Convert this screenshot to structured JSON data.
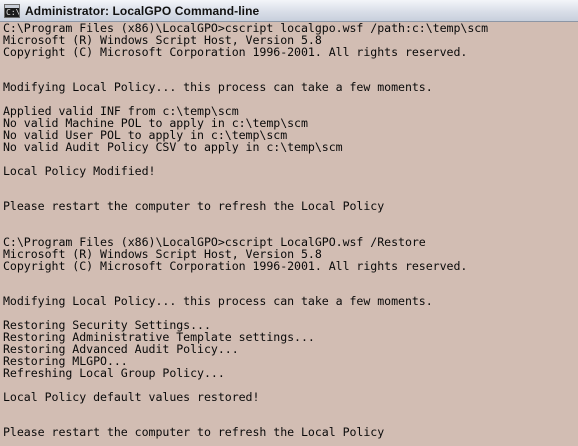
{
  "window": {
    "title": "Administrator: LocalGPO Command-line",
    "icon": "console-icon",
    "icon_glyph": "C:\\"
  },
  "console": {
    "lines": [
      "C:\\Program Files (x86)\\LocalGPO>cscript localgpo.wsf /path:c:\\temp\\scm",
      "Microsoft (R) Windows Script Host, Version 5.8",
      "Copyright (C) Microsoft Corporation 1996-2001. All rights reserved.",
      "",
      "",
      "Modifying Local Policy... this process can take a few moments.",
      "",
      "Applied valid INF from c:\\temp\\scm",
      "No valid Machine POL to apply in c:\\temp\\scm",
      "No valid User POL to apply in c:\\temp\\scm",
      "No valid Audit Policy CSV to apply in c:\\temp\\scm",
      "",
      "Local Policy Modified!",
      "",
      "",
      "Please restart the computer to refresh the Local Policy",
      "",
      "",
      "C:\\Program Files (x86)\\LocalGPO>cscript LocalGPO.wsf /Restore",
      "Microsoft (R) Windows Script Host, Version 5.8",
      "Copyright (C) Microsoft Corporation 1996-2001. All rights reserved.",
      "",
      "",
      "Modifying Local Policy... this process can take a few moments.",
      "",
      "Restoring Security Settings...",
      "Restoring Administrative Template settings...",
      "Restoring Advanced Audit Policy...",
      "Restoring MLGPO...",
      "Refreshing Local Group Policy...",
      "",
      "Local Policy default values restored!",
      "",
      "",
      "Please restart the computer to refresh the Local Policy"
    ]
  },
  "colors": {
    "console_background": "#d2bdb3",
    "console_text": "#0a0a0a",
    "titlebar": "#d9dee8"
  }
}
